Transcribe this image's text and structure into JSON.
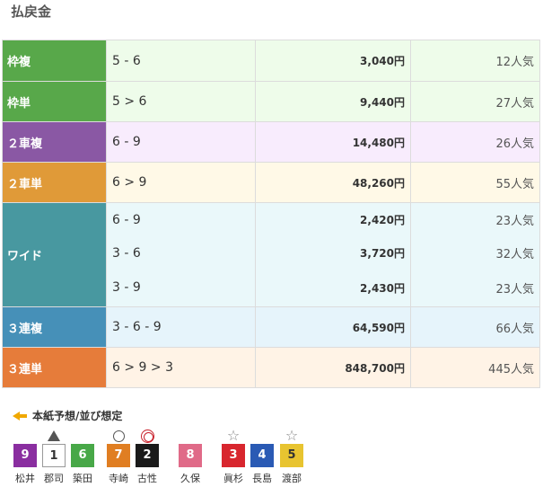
{
  "page_title": "払戻金",
  "payouts": [
    {
      "type": "枠複",
      "combo": "5 - 6",
      "amount": "3,040円",
      "popularity": "12人気"
    },
    {
      "type": "枠単",
      "combo": "5 > 6",
      "amount": "9,440円",
      "popularity": "27人気"
    },
    {
      "type": "２車複",
      "combo": "6 - 9",
      "amount": "14,480円",
      "popularity": "26人気"
    },
    {
      "type": "２車単",
      "combo": "6 > 9",
      "amount": "48,260円",
      "popularity": "55人気"
    },
    {
      "type": "ワイド",
      "entries": [
        {
          "combo": "6 - 9",
          "amount": "2,420円",
          "popularity": "23人気"
        },
        {
          "combo": "3 - 6",
          "amount": "3,720円",
          "popularity": "32人気"
        },
        {
          "combo": "3 - 9",
          "amount": "2,430円",
          "popularity": "23人気"
        }
      ]
    },
    {
      "type": "３連複",
      "combo": "3 - 6 - 9",
      "amount": "64,590円",
      "popularity": "66人気"
    },
    {
      "type": "３連単",
      "combo": "6 > 9 > 3",
      "amount": "848,700円",
      "popularity": "445人気"
    }
  ],
  "lineup": {
    "title": "本紙予想/並び想定",
    "racers": [
      {
        "number": "9",
        "name": "松井",
        "mark": "",
        "color": "#8a2ea0",
        "text_color": "#ffffff"
      },
      {
        "number": "1",
        "name": "郡司",
        "mark": "triangle",
        "color": "#ffffff",
        "text_color": "#333333"
      },
      {
        "number": "6",
        "name": "築田",
        "mark": "",
        "color": "#48a848",
        "text_color": "#ffffff"
      },
      {
        "number": "7",
        "name": "寺崎",
        "mark": "circle",
        "color": "#e07e22",
        "text_color": "#ffffff"
      },
      {
        "number": "2",
        "name": "古性",
        "mark": "double-circle",
        "color": "#1a1a1a",
        "text_color": "#ffffff"
      },
      {
        "number": "8",
        "name": "久保",
        "mark": "",
        "color": "#e06a88",
        "text_color": "#ffffff"
      },
      {
        "number": "3",
        "name": "眞杉",
        "mark": "star",
        "color": "#d8262e",
        "text_color": "#ffffff"
      },
      {
        "number": "4",
        "name": "長島",
        "mark": "",
        "color": "#2a5ab4",
        "text_color": "#ffffff"
      },
      {
        "number": "5",
        "name": "渡部",
        "mark": "star",
        "color": "#e8c430",
        "text_color": "#333333"
      }
    ]
  }
}
